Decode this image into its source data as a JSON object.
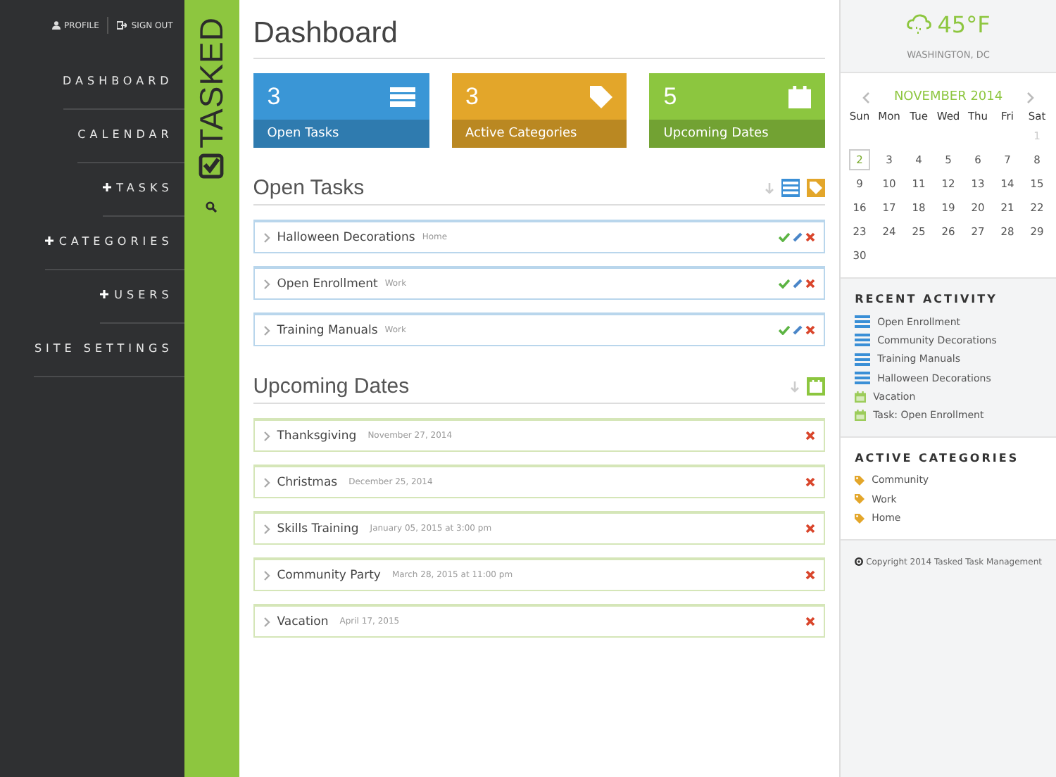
{
  "top_links": [
    {
      "label": "PROFILE",
      "kind": "user"
    },
    {
      "label": "SIGN OUT",
      "kind": "signout"
    }
  ],
  "nav": [
    {
      "label": "DASHBOARD",
      "expandable": false
    },
    {
      "label": "CALENDAR",
      "expandable": false
    },
    {
      "label": "TASKS",
      "expandable": true
    },
    {
      "label": "CATEGORIES",
      "expandable": true
    },
    {
      "label": "USERS",
      "expandable": true
    },
    {
      "label": "SITE SETTINGS",
      "expandable": false
    }
  ],
  "brand": {
    "name": "TASKED"
  },
  "page_title": "Dashboard",
  "stats": [
    {
      "value": "3",
      "label": "Open Tasks",
      "kind": "tasks",
      "color": "#3a96d6"
    },
    {
      "value": "3",
      "label": "Active Categories",
      "kind": "categories",
      "color": "#e3a62a"
    },
    {
      "value": "5",
      "label": "Upcoming Dates",
      "kind": "dates",
      "color": "#8cc63f"
    }
  ],
  "open_tasks": {
    "title": "Open Tasks",
    "tools": [
      {
        "kind": "list"
      },
      {
        "kind": "tag"
      }
    ],
    "rows": [
      {
        "name": "Halloween Decorations",
        "category": "Home"
      },
      {
        "name": "Open Enrollment",
        "category": "Work"
      },
      {
        "name": "Training Manuals",
        "category": "Work"
      }
    ]
  },
  "upcoming_dates": {
    "title": "Upcoming Dates",
    "tools": [
      {
        "kind": "calendar"
      }
    ],
    "rows": [
      {
        "name": "Thanksgiving",
        "date": "November 27, 2014"
      },
      {
        "name": "Christmas",
        "date": "December 25, 2014"
      },
      {
        "name": "Skills Training",
        "date": "January 05, 2015 at 3:00 pm"
      },
      {
        "name": "Community Party",
        "date": "March 28, 2015 at 11:00 pm"
      },
      {
        "name": "Vacation",
        "date": "April 17, 2015"
      }
    ]
  },
  "weather": {
    "temperature": "45°F",
    "location": "WASHINGTON, DC"
  },
  "calendar": {
    "month": "NOVEMBER 2014",
    "weekdays": [
      "Sun",
      "Mon",
      "Tue",
      "Wed",
      "Thu",
      "Fri",
      "Sat"
    ],
    "weeks": [
      [
        {
          "day": "1",
          "muted": true,
          "selected": false
        }
      ],
      [
        {
          "day": "2",
          "muted": false,
          "selected": true
        },
        {
          "day": "3",
          "muted": false,
          "selected": false
        },
        {
          "day": "4",
          "muted": false,
          "selected": false
        },
        {
          "day": "5",
          "muted": false,
          "selected": false
        },
        {
          "day": "6",
          "muted": false,
          "selected": false
        },
        {
          "day": "7",
          "muted": false,
          "selected": false
        },
        {
          "day": "8",
          "muted": false,
          "selected": false
        }
      ],
      [
        {
          "day": "9",
          "muted": false,
          "selected": false
        },
        {
          "day": "10",
          "muted": false,
          "selected": false
        },
        {
          "day": "11",
          "muted": false,
          "selected": false
        },
        {
          "day": "12",
          "muted": false,
          "selected": false
        },
        {
          "day": "13",
          "muted": false,
          "selected": false
        },
        {
          "day": "14",
          "muted": false,
          "selected": false
        },
        {
          "day": "15",
          "muted": false,
          "selected": false
        }
      ],
      [
        {
          "day": "16",
          "muted": false,
          "selected": false
        },
        {
          "day": "17",
          "muted": false,
          "selected": false
        },
        {
          "day": "18",
          "muted": false,
          "selected": false
        },
        {
          "day": "19",
          "muted": false,
          "selected": false
        },
        {
          "day": "20",
          "muted": false,
          "selected": false
        },
        {
          "day": "21",
          "muted": false,
          "selected": false
        },
        {
          "day": "22",
          "muted": false,
          "selected": false
        }
      ],
      [
        {
          "day": "23",
          "muted": false,
          "selected": false
        },
        {
          "day": "24",
          "muted": false,
          "selected": false
        },
        {
          "day": "25",
          "muted": false,
          "selected": false
        },
        {
          "day": "26",
          "muted": false,
          "selected": false
        },
        {
          "day": "27",
          "muted": false,
          "selected": false
        },
        {
          "day": "28",
          "muted": false,
          "selected": false
        },
        {
          "day": "29",
          "muted": false,
          "selected": false
        }
      ],
      [
        {
          "day": "30",
          "muted": false,
          "selected": false
        }
      ]
    ]
  },
  "recent_activity": {
    "title": "RECENT ACTIVITY",
    "items": [
      {
        "label": "Open Enrollment",
        "kind": "task"
      },
      {
        "label": "Community Decorations",
        "kind": "task"
      },
      {
        "label": "Training Manuals",
        "kind": "task"
      },
      {
        "label": "Halloween Decorations",
        "kind": "task"
      },
      {
        "label": "Vacation",
        "kind": "date"
      },
      {
        "label": "Task: Open Enrollment",
        "kind": "date"
      }
    ]
  },
  "active_categories": {
    "title": "ACTIVE CATEGORIES",
    "items": [
      "Community",
      "Work",
      "Home"
    ]
  },
  "footer": "Copyright 2014 Tasked Task Management"
}
